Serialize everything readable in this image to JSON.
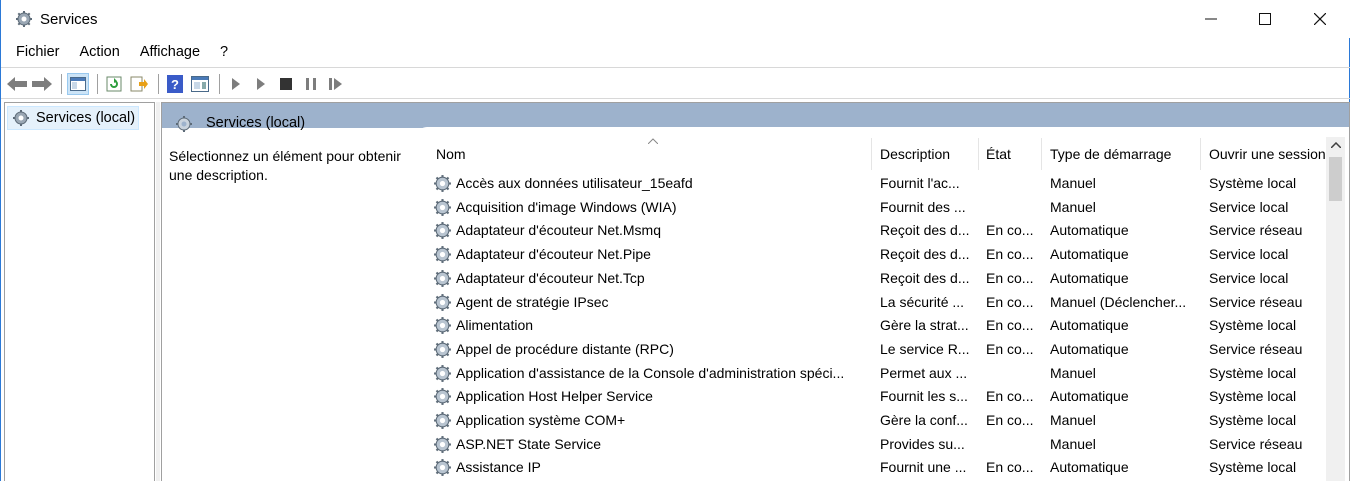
{
  "window": {
    "title": "Services",
    "minimize": "—",
    "maximize": "☐",
    "close": "✕"
  },
  "menu": [
    "Fichier",
    "Action",
    "Affichage",
    "?"
  ],
  "tree": {
    "item": "Services (local)"
  },
  "panel": {
    "header": "Services (local)",
    "description": "Sélectionnez un élément pour obtenir une description."
  },
  "columns": {
    "name": "Nom",
    "description": "Description",
    "state": "État",
    "startup": "Type de démarrage",
    "logon": "Ouvrir une session"
  },
  "services": [
    {
      "name": "Accès aux données utilisateur_15eafd",
      "desc": "Fournit l'ac...",
      "state": "",
      "startup": "Manuel",
      "logon": "Système local"
    },
    {
      "name": "Acquisition d'image Windows (WIA)",
      "desc": "Fournit des ...",
      "state": "",
      "startup": "Manuel",
      "logon": "Service local"
    },
    {
      "name": "Adaptateur d'écouteur Net.Msmq",
      "desc": "Reçoit des d...",
      "state": "En co...",
      "startup": "Automatique",
      "logon": "Service réseau"
    },
    {
      "name": "Adaptateur d'écouteur Net.Pipe",
      "desc": "Reçoit des d...",
      "state": "En co...",
      "startup": "Automatique",
      "logon": "Service local"
    },
    {
      "name": "Adaptateur d'écouteur Net.Tcp",
      "desc": "Reçoit des d...",
      "state": "En co...",
      "startup": "Automatique",
      "logon": "Service local"
    },
    {
      "name": "Agent de stratégie IPsec",
      "desc": "La sécurité ...",
      "state": "En co...",
      "startup": "Manuel (Déclencher...",
      "logon": "Service réseau"
    },
    {
      "name": "Alimentation",
      "desc": "Gère la strat...",
      "state": "En co...",
      "startup": "Automatique",
      "logon": "Système local"
    },
    {
      "name": "Appel de procédure distante (RPC)",
      "desc": "Le service R...",
      "state": "En co...",
      "startup": "Automatique",
      "logon": "Service réseau"
    },
    {
      "name": "Application d'assistance de la Console d'administration spéci...",
      "desc": "Permet aux ...",
      "state": "",
      "startup": "Manuel",
      "logon": "Système local"
    },
    {
      "name": "Application Host Helper Service",
      "desc": "Fournit les s...",
      "state": "En co...",
      "startup": "Automatique",
      "logon": "Système local"
    },
    {
      "name": "Application système COM+",
      "desc": "Gère la conf...",
      "state": "En co...",
      "startup": "Manuel",
      "logon": "Système local"
    },
    {
      "name": "ASP.NET State Service",
      "desc": "Provides su...",
      "state": "",
      "startup": "Manuel",
      "logon": "Service réseau"
    },
    {
      "name": "Assistance IP",
      "desc": "Fournit une ...",
      "state": "En co...",
      "startup": "Automatique",
      "logon": "Système local"
    }
  ],
  "colors": {
    "header_bg": "#9db2cc",
    "selection_bg": "#e5f1fb",
    "window_border": "#2b79d7"
  }
}
